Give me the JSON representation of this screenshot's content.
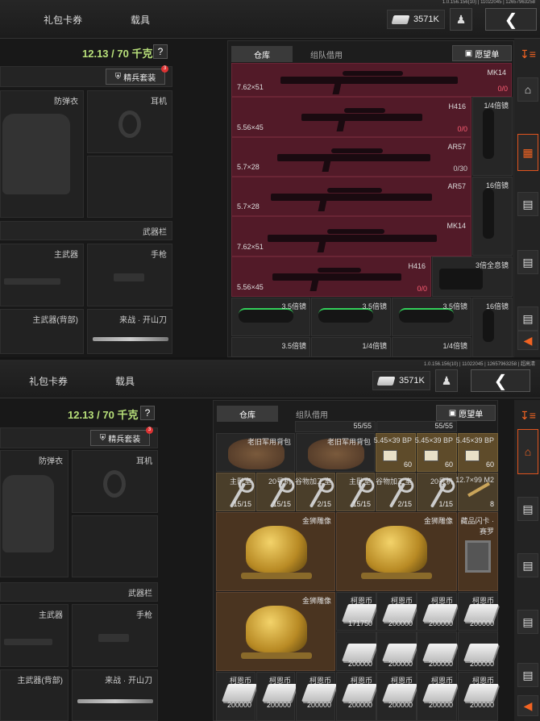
{
  "shot1": {
    "version": "1.0.156.156(10) | 11022045 | 12657963258",
    "tabs": [
      "礼包卡券",
      "载具"
    ],
    "coins": "3571K",
    "weight": "12.13 / 70 千克",
    "help": "?",
    "kit_button": "精兵套装",
    "kit_badge": "3",
    "equipment": {
      "armor": "防弹衣",
      "headset": "耳机",
      "weapon_bar": "武器栏",
      "primary": "主武器",
      "pistol": "手枪",
      "primary_back": "主武器(背部)",
      "melee": "来战 · 开山刀"
    },
    "stash_tabs": [
      "仓库",
      "组队借用"
    ],
    "wishlist": "愿望单",
    "weapons": [
      {
        "caliber": "7.62×51",
        "name": "MK14",
        "ammo": "0/0",
        "ammo_gray": false
      },
      {
        "caliber": "5.56×45",
        "name": "H416",
        "ammo": "0/0",
        "ammo_gray": false
      },
      {
        "caliber": "5.7×28",
        "name": "AR57",
        "ammo": "0/30",
        "ammo_gray": true
      },
      {
        "caliber": "5.7×28",
        "name": "AR57",
        "ammo": "",
        "ammo_gray": false
      },
      {
        "caliber": "7.62×51",
        "name": "MK14",
        "ammo": "",
        "ammo_gray": false
      },
      {
        "caliber": "5.56×45",
        "name": "H416",
        "ammo": "0/0",
        "ammo_gray": false
      }
    ],
    "side_items": [
      "1/4倍镜",
      "16倍镜",
      "3倍全息镜"
    ],
    "scope_row1": [
      "3.5倍镜",
      "3.5倍镜",
      "3.5倍镜",
      "16倍镜"
    ],
    "scope_row2": [
      "3.5倍镜",
      "1/4倍镜",
      "1/4倍镜"
    ]
  },
  "shot2": {
    "version": "1.0.156.156(10) | 11022045 | 12657963258 | 超高清",
    "tabs": [
      "礼包卡券",
      "载具"
    ],
    "coins": "3571K",
    "weight": "12.13 / 70 千克",
    "kit_button": "精兵套装",
    "kit_badge": "3",
    "equipment": {
      "armor": "防弹衣",
      "headset": "耳机",
      "weapon_bar": "武器栏",
      "primary": "主武器",
      "pistol": "手枪",
      "primary_back": "主武器(背部)",
      "melee": "来战 · 开山刀"
    },
    "stash_tabs": [
      "仓库",
      "组队借用"
    ],
    "wishlist": "愿望单",
    "top_counts": [
      "55/55",
      "55/55"
    ],
    "bags": [
      "老旧军用背包",
      "老旧军用背包"
    ],
    "ammo": [
      {
        "label": "5.45×39 BP",
        "count": "60"
      },
      {
        "label": "5.45×39 BP",
        "count": "60"
      },
      {
        "label": "5.45×39 BP",
        "count": "60"
      }
    ],
    "keys": [
      {
        "label": "主卧室",
        "count": "15/15"
      },
      {
        "label": "20号机",
        "count": "15/15"
      },
      {
        "label": "谷物加工室",
        "count": "2/15"
      },
      {
        "label": "主卧室",
        "count": "15/15"
      },
      {
        "label": "谷物加工室",
        "count": "2/15"
      },
      {
        "label": "20号机",
        "count": "1/15"
      },
      {
        "label": "12.7×99 M2",
        "count": "8"
      }
    ],
    "gold_lion": "金狮雕像",
    "flash_card": "藏品闪卡 · 赛罗",
    "cash_label": "柯恩币",
    "cash_right_r1": [
      "171750",
      "200000",
      "200000",
      "200000"
    ],
    "cash_right_r2": [
      "200000",
      "200000",
      "200000",
      "200000"
    ],
    "cash_bottom": [
      "200000",
      "200000",
      "200000",
      "200000",
      "200000",
      "200000",
      "200000"
    ]
  }
}
